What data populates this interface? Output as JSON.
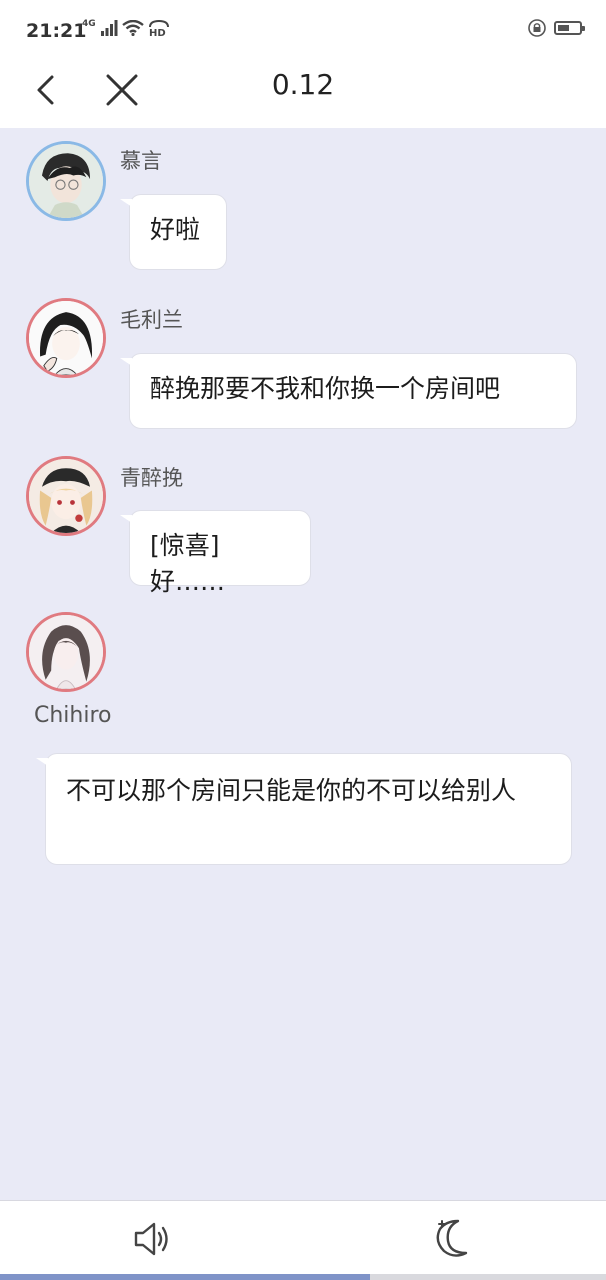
{
  "status_bar": {
    "time": "21:21",
    "network_badge": "4G",
    "icons": [
      "signal-icon",
      "wifi-icon",
      "hd-icon",
      "lock-icon",
      "battery-icon"
    ],
    "battery_level": 0.62
  },
  "header": {
    "title": "0.12",
    "back_icon": "chevron-left-icon",
    "close_icon": "close-icon"
  },
  "messages": [
    {
      "sender": "慕言",
      "text": "好啦",
      "avatar_ring": "#8ab9e6"
    },
    {
      "sender": "毛利兰",
      "text": "醉挽那要不我和你换一个房间吧",
      "avatar_ring": "#e07a80"
    },
    {
      "sender": "青醉挽",
      "text": "[惊喜]好……",
      "avatar_ring": "#e07a80"
    },
    {
      "sender": "Chihiro",
      "text": "不可以那个房间只能是你的不可以给别人",
      "avatar_ring": "#e07a80"
    }
  ],
  "bottom_bar": {
    "sound_icon": "speaker-icon",
    "night_icon": "moon-icon",
    "progress": 0.61
  },
  "colors": {
    "chat_background": "#e9eaf6",
    "bubble": "#ffffff",
    "progress_fill": "#7f93c8"
  }
}
